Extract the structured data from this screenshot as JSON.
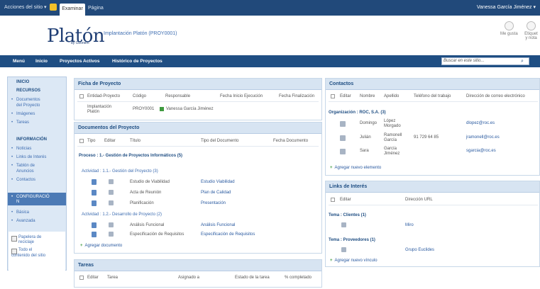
{
  "topbar": {
    "site_actions": "Acciones del sitio ▾",
    "tab_examinar": "Examinar",
    "tab_pagina": "Página",
    "user": "Vanessa García Jiménez ▾"
  },
  "header": {
    "logo": "Platón",
    "logo_sub": "by Ozonem",
    "site_title": "Implantación Platón (PROY0001)",
    "social_like": "Me gusta",
    "social_tags_1": "Etiquet",
    "social_tags_2": "y nota"
  },
  "nav": {
    "items": [
      "Menú",
      "Inicio",
      "Proyectos Activos",
      "Histórico de Proyectos"
    ],
    "search_placeholder": "Buscar en este sitio...",
    "search_icon": "search-icon"
  },
  "leftnav": {
    "inicio": "INICIO",
    "recursos": "RECURSOS",
    "documentos_1": "Documentos",
    "documentos_2": "del Proyecto",
    "imagenes": "Imágenes",
    "tareas": "Tareas",
    "informacion": "INFORMACIÓN",
    "noticias": "Noticias",
    "links": "Links de Interés",
    "tablon_1": "Tablón de",
    "tablon_2": "Anuncios",
    "contactos": "Contactos",
    "config_1": "CONFIGURACIÓ",
    "config_2": "N",
    "basica": "Básica",
    "avanzada": "Avanzada",
    "papelera_1": "Papelera de",
    "papelera_2": "reciclaje",
    "todo_1": "Todo el",
    "todo_2": "contenido del sitio"
  },
  "ficha": {
    "title": "Ficha de Proyecto",
    "headers": [
      "Entidad-Proyecto",
      "Código",
      "Responsable",
      "Fecha Inicio Ejecución",
      "Fecha Finalización"
    ],
    "entidad_1": "Implantación",
    "entidad_2": "Platón",
    "codigo": "PROY0001",
    "responsable": "Vanessa García Jiménez"
  },
  "documentos": {
    "title": "Documentos del Proyecto",
    "headers": [
      "Tipo",
      "Editar",
      "Título",
      "Tipo del Documento",
      "Fecha Documento"
    ],
    "proceso": "Proceso : 1.- Gestión de Proyectos Informáticos (5)",
    "actividad1": "Actividad : 1.1.- Gestión del Proyecto (3)",
    "actividad1_rows": [
      {
        "titulo": "Estudio de Viabilidad",
        "tipo": "Estudio Viabilidad"
      },
      {
        "titulo": "Acta de Reunión",
        "tipo": "Plan de Calidad"
      },
      {
        "titulo": "Planificación",
        "tipo": "Presentación"
      }
    ],
    "actividad2": "Actividad : 1.2.- Desarrollo de Proyecto (2)",
    "actividad2_rows": [
      {
        "titulo": "Análisis Funcional",
        "tipo": "Análisis Funcional"
      },
      {
        "titulo": "Especificación de Requisitos",
        "tipo": "Especificación de Requisitos"
      }
    ],
    "add": "Agregar documento"
  },
  "tareas": {
    "title": "Tareas",
    "headers": [
      "Editar",
      "Tarea",
      "Asignado a",
      "Estado de la tarea",
      "% completado"
    ]
  },
  "contactos": {
    "title": "Contactos",
    "headers": [
      "Editar",
      "Nombre",
      "Apellido",
      "Teléfono del trabajo",
      "Dirección de correo electrónico"
    ],
    "organizacion": "Organización : ROC, S.A. (3)",
    "rows": [
      {
        "nombre": "Domingo",
        "apellido_1": "López",
        "apellido_2": "Morgado",
        "telefono": "",
        "email": "dlopez@roc.es"
      },
      {
        "nombre": "Julián",
        "apellido_1": "Ramonell",
        "apellido_2": "García",
        "telefono": "91 729 64 85",
        "email": "jramonell@roc.es"
      },
      {
        "nombre": "Sara",
        "apellido_1": "García",
        "apellido_2": "Jiménez",
        "telefono": "",
        "email": "sgarcia@roc.es"
      }
    ],
    "add": "Agregar nuevo elemento"
  },
  "links": {
    "title": "Links de Interés",
    "headers": [
      "Editar",
      "Dirección URL"
    ],
    "tema1": "Tema : Clientes (1)",
    "tema1_url": "Miro",
    "tema2": "Tema : Proveedores (1)",
    "tema2_url": "Grupo Euclides",
    "add": "Agregar nuevo vínculo"
  }
}
